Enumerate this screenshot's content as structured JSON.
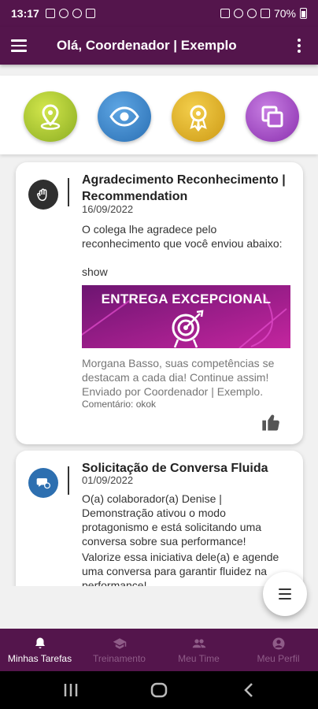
{
  "status_bar": {
    "time": "13:17",
    "battery": "70%"
  },
  "app_bar": {
    "title": "Olá, Coordenador | Exemplo"
  },
  "quick_actions": [
    {
      "icon": "location-pin-icon",
      "color": "#a8c43a"
    },
    {
      "icon": "eye-icon",
      "color": "#2f7fc1"
    },
    {
      "icon": "award-ribbon-icon",
      "color": "#e2b12a"
    },
    {
      "icon": "copy-icon",
      "color": "#a14dc1"
    }
  ],
  "cards": [
    {
      "title": "Agradecimento Reconhecimento | Recommendation",
      "date": "16/09/2022",
      "message": "O colega lhe agradece pelo reconhecimento que você enviou abaixo:",
      "value": "show",
      "banner_text": "ENTREGA EXCEPCIONAL",
      "recognition_text": "Morgana Basso, suas competências se destacam a cada dia! Continue assim!",
      "sender": "Enviado por Coordenador | Exemplo.",
      "comment": "Comentário: okok"
    },
    {
      "title": "Solicitação de Conversa Fluida",
      "date": "01/09/2022",
      "message": "O(a) colaborador(a) Denise | Demonstração ativou o modo protagonismo e está solicitando uma conversa sobre sua performance!",
      "message2": "Valorize essa iniciativa dele(a) e agende uma conversa para garantir fluidez na performance!"
    }
  ],
  "bottom_nav": [
    {
      "label": "Minhas Tarefas",
      "icon": "bell-icon",
      "active": true
    },
    {
      "label": "Treinamento",
      "icon": "graduation-cap-icon",
      "active": false
    },
    {
      "label": "Meu Time",
      "icon": "team-icon",
      "active": false
    },
    {
      "label": "Meu Perfil",
      "icon": "profile-icon",
      "active": false
    }
  ],
  "colors": {
    "primary": "#54154c",
    "background": "#f1f1f1",
    "banner": "#9c1e8e"
  }
}
